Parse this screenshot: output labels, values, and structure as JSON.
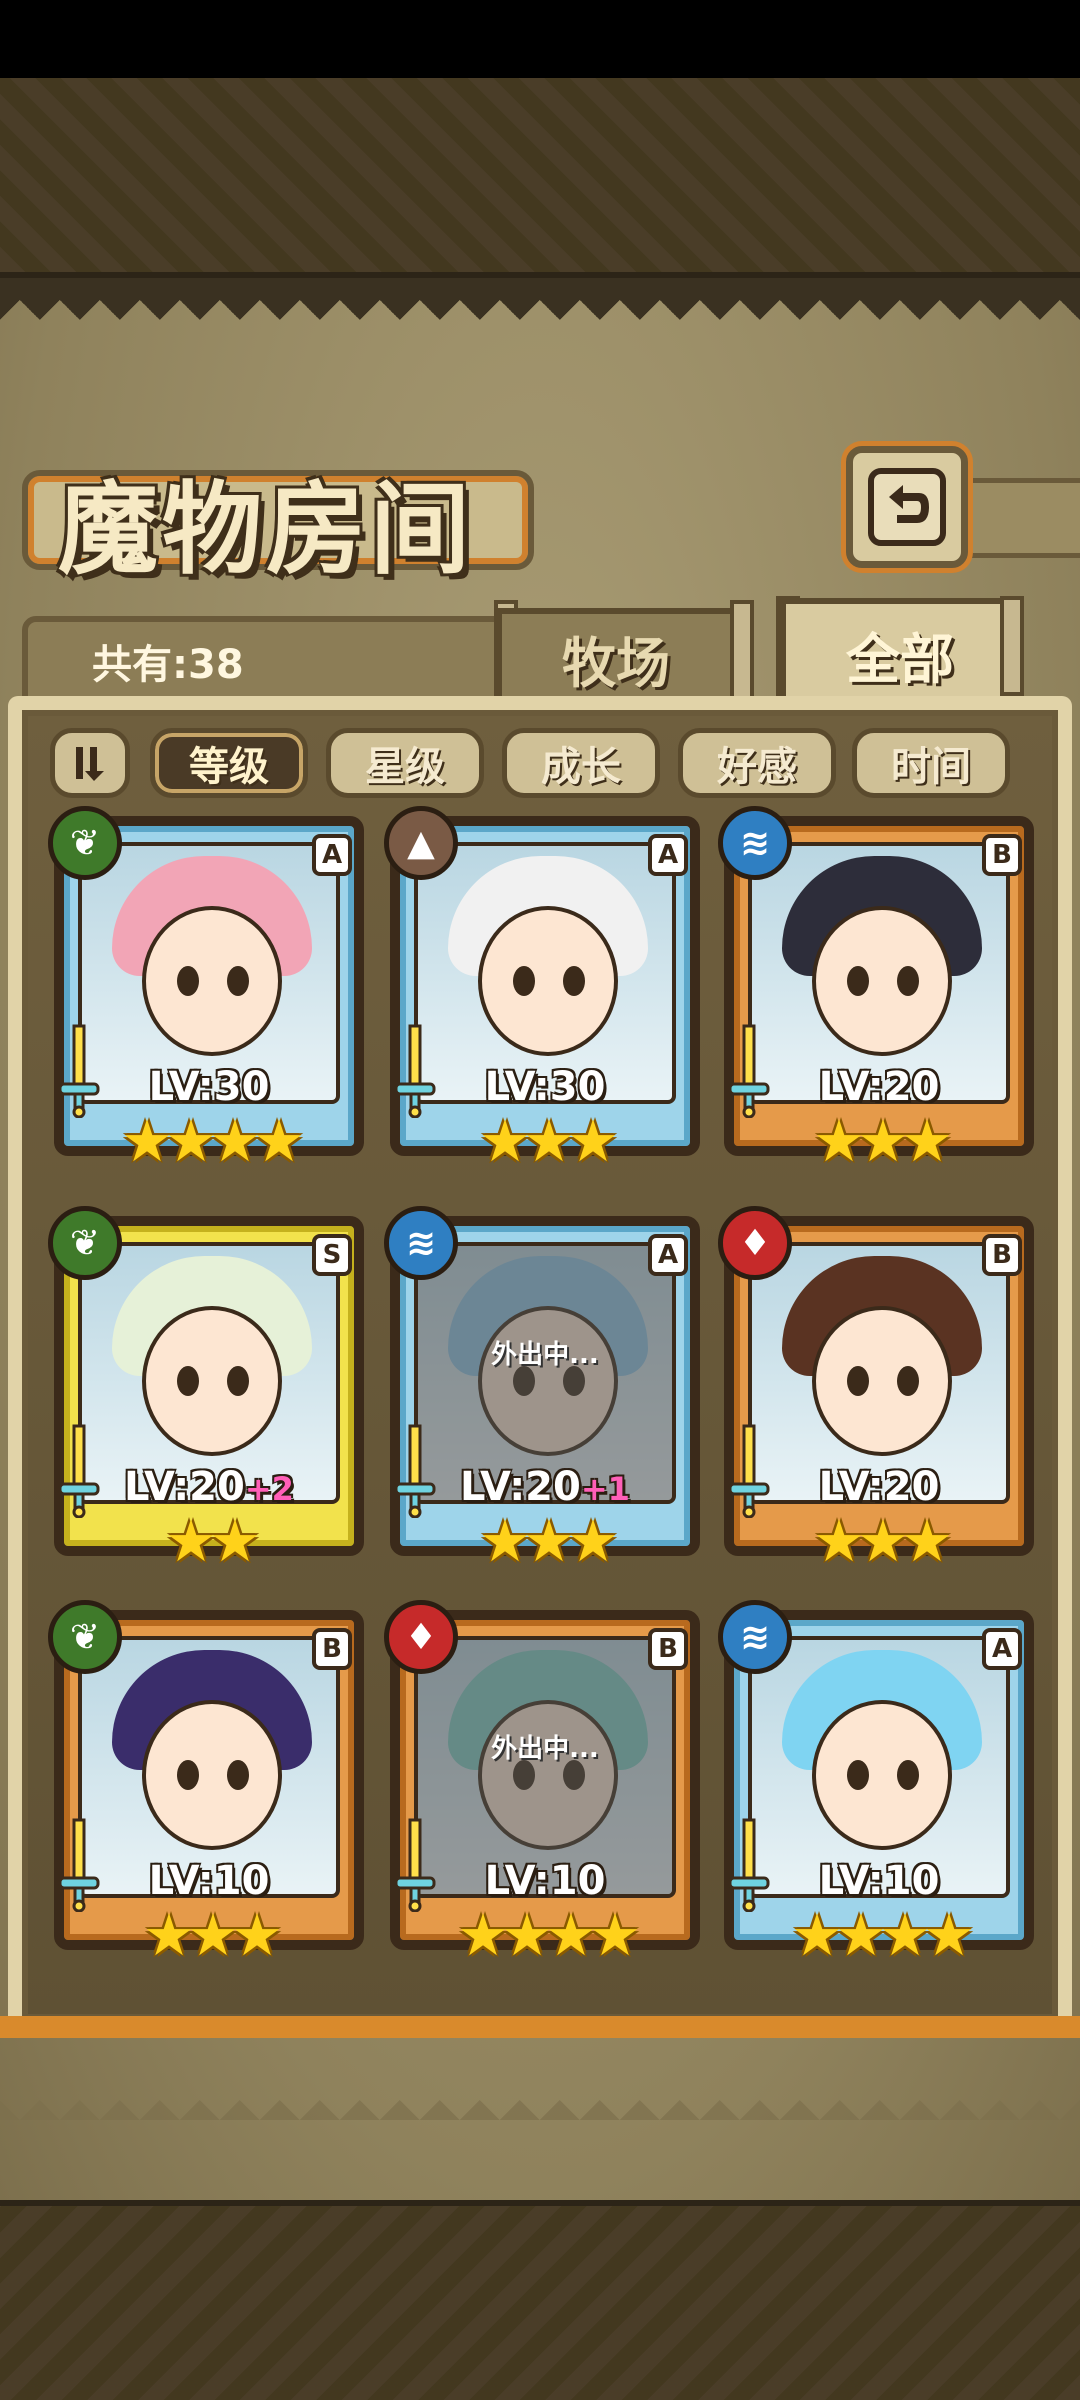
{
  "header": {
    "title": "魔物房间",
    "back_icon": "back-arrow-icon"
  },
  "count": {
    "label": "共有:38"
  },
  "tabs": [
    {
      "label": "牧场",
      "active": false
    },
    {
      "label": "全部",
      "active": true
    }
  ],
  "sort": {
    "toggle_icon": "sort-order-icon",
    "options": [
      {
        "label": "等级",
        "active": true
      },
      {
        "label": "星级",
        "active": false
      },
      {
        "label": "成长",
        "active": false
      },
      {
        "label": "好感",
        "active": false
      },
      {
        "label": "时间",
        "active": false
      }
    ]
  },
  "monsters": [
    {
      "element": "leaf",
      "rank": "A",
      "level": "LV:30",
      "bonus": "",
      "stars": 4,
      "away": false,
      "hair": "#f2a5b6",
      "frame": "A"
    },
    {
      "element": "earth",
      "rank": "A",
      "level": "LV:30",
      "bonus": "",
      "stars": 3,
      "away": false,
      "hair": "#f1f1f1",
      "frame": "A"
    },
    {
      "element": "water",
      "rank": "B",
      "level": "LV:20",
      "bonus": "",
      "stars": 3,
      "away": false,
      "hair": "#2d2d3a",
      "frame": "B"
    },
    {
      "element": "leaf",
      "rank": "S",
      "level": "LV:20",
      "bonus": "+2",
      "stars": 2,
      "away": false,
      "hair": "#e6f1d8",
      "frame": "S"
    },
    {
      "element": "water",
      "rank": "A",
      "level": "LV:20",
      "bonus": "+1",
      "stars": 3,
      "away": true,
      "away_text": "外出中...",
      "hair": "#8fc7e8",
      "frame": "A"
    },
    {
      "element": "fire",
      "rank": "B",
      "level": "LV:20",
      "bonus": "",
      "stars": 3,
      "away": false,
      "hair": "#5a3322",
      "frame": "B"
    },
    {
      "element": "leaf",
      "rank": "B",
      "level": "LV:10",
      "bonus": "",
      "stars": 3,
      "away": false,
      "hair": "#3a2d6b",
      "frame": "B"
    },
    {
      "element": "fire",
      "rank": "B",
      "level": "LV:10",
      "bonus": "",
      "stars": 4,
      "away": true,
      "away_text": "外出中...",
      "hair": "#7fd0c8",
      "frame": "B"
    },
    {
      "element": "water",
      "rank": "A",
      "level": "LV:10",
      "bonus": "",
      "stars": 4,
      "away": false,
      "hair": "#7fd4f2",
      "frame": "A"
    }
  ],
  "colors": {
    "leaf": "#3f7a2a",
    "water": "#2f7fc2",
    "earth": "#7a5a45",
    "fire": "#c62a2a",
    "star": "#ffd21a"
  }
}
